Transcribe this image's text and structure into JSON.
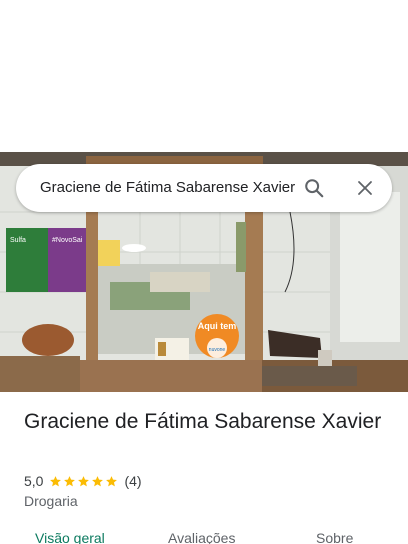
{
  "search": {
    "query": "Graciene de Fátima Sabarense Xavier"
  },
  "icons": {
    "search": "search-icon",
    "close": "close-icon",
    "star": "star-icon"
  },
  "photo": {
    "poster_hashtag": "#NovoSai",
    "poster_left_text": "Sulfa",
    "sign_text": "Aqui tem",
    "sign_brand": "nuvone"
  },
  "place": {
    "title": "Graciene de Fátima Sabarense Xavier",
    "rating": "5,0",
    "stars_value": 5,
    "stars_max": 5,
    "review_count": "(4)",
    "category": "Drogaria"
  },
  "tabs": [
    {
      "label": "Visão geral",
      "selected": true
    },
    {
      "label": "Avaliações",
      "selected": false
    },
    {
      "label": "Sobre",
      "selected": false
    }
  ],
  "colors": {
    "star": "#fbbc04",
    "selected_tab": "#0b7a5f",
    "text_primary": "#202124",
    "text_secondary": "#5f6368"
  }
}
